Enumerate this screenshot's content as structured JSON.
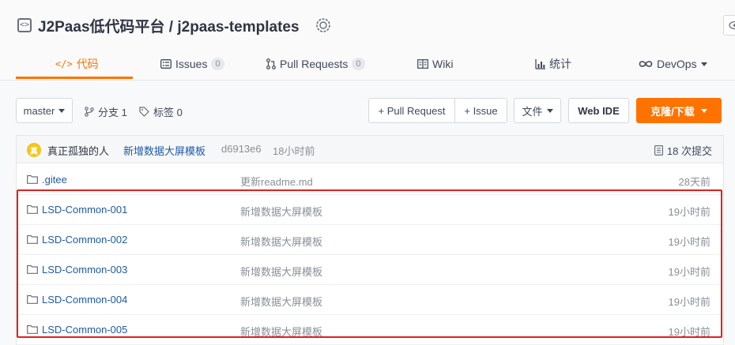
{
  "repo": {
    "title": "J2Paas低代码平台 / j2paas-templates"
  },
  "tabs": [
    {
      "label": "代码",
      "count": null
    },
    {
      "label": "Issues",
      "count": "0"
    },
    {
      "label": "Pull Requests",
      "count": "0"
    },
    {
      "label": "Wiki",
      "count": null
    },
    {
      "label": "统计",
      "count": null
    },
    {
      "label": "DevOps",
      "count": null
    }
  ],
  "toolbar": {
    "branch": "master",
    "branches": "分支 1",
    "tags": "标签 0",
    "pull_request": "+ Pull Request",
    "issue": "+ Issue",
    "file": "文件",
    "web_ide": "Web IDE",
    "clone": "克隆/下载"
  },
  "commit": {
    "avatar_letter": "真",
    "author": "真正孤独的人",
    "message": "新增数据大屏模板",
    "hash": "d6913e6",
    "time": "18小时前",
    "count": "18 次提交"
  },
  "files": [
    {
      "name": ".gitee",
      "message": "更新readme.md",
      "time": "28天前"
    },
    {
      "name": "LSD-Common-001",
      "message": "新增数据大屏模板",
      "time": "19小时前"
    },
    {
      "name": "LSD-Common-002",
      "message": "新增数据大屏模板",
      "time": "19小时前"
    },
    {
      "name": "LSD-Common-003",
      "message": "新增数据大屏模板",
      "time": "19小时前"
    },
    {
      "name": "LSD-Common-004",
      "message": "新增数据大屏模板",
      "time": "19小时前"
    },
    {
      "name": "LSD-Common-005",
      "message": "新增数据大屏模板",
      "time": "19小时前"
    }
  ],
  "colors": {
    "accent": "#fe7300",
    "link": "#1e5aa8",
    "highlight": "#e0201d"
  }
}
